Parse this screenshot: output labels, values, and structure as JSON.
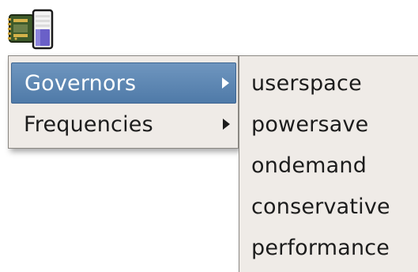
{
  "tray": {
    "icon": "cpu-frequency-icon"
  },
  "menu": {
    "items": [
      {
        "label": "Governors",
        "active": true,
        "has_submenu": true
      },
      {
        "label": "Frequencies",
        "active": false,
        "has_submenu": true
      }
    ]
  },
  "submenu": {
    "items": [
      {
        "label": "userspace"
      },
      {
        "label": "powersave"
      },
      {
        "label": "ondemand"
      },
      {
        "label": "conservative"
      },
      {
        "label": "performance"
      }
    ]
  },
  "colors": {
    "menu_background": "#efebe7",
    "highlight": "#5b84b1",
    "highlight_text": "#ffffff",
    "text": "#1c1c1c",
    "border": "#8a8782"
  }
}
